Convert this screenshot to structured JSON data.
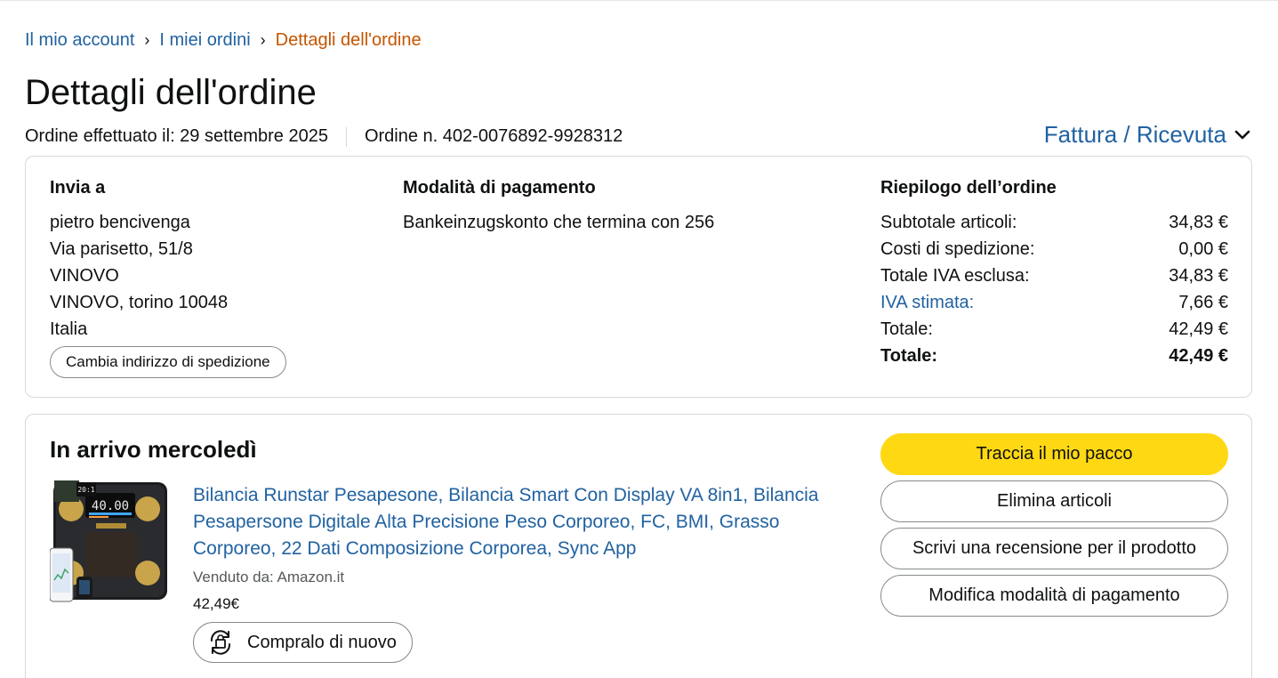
{
  "breadcrumb": {
    "items": [
      "Il mio account",
      "I miei ordini"
    ],
    "current": "Dettagli dell'ordine",
    "separator": "›"
  },
  "page_title": "Dettagli dell'ordine",
  "order_meta": {
    "placed": "Ordine effettuato il: 29 settembre 2025",
    "number": "Ordine n. 402-0076892-9928312"
  },
  "invoice": {
    "label": "Fattura / Ricevuta",
    "icon": "chevron-down-icon"
  },
  "shipping": {
    "heading": "Invia a",
    "lines": [
      "pietro bencivenga",
      "Via parisetto, 51/8",
      "VINOVO",
      "VINOVO, torino 10048",
      "Italia"
    ],
    "change_button": "Cambia indirizzo di spedizione"
  },
  "payment": {
    "heading": "Modalità di pagamento",
    "method": "Bankeinzugskonto che termina con 256"
  },
  "summary": {
    "heading": "Riepilogo dell’ordine",
    "rows": [
      {
        "k": "Subtotale articoli:",
        "v": "34,83 €"
      },
      {
        "k": "Costi di spedizione:",
        "v": "0,00 €"
      },
      {
        "k": "Totale IVA esclusa:",
        "v": "34,83 €"
      },
      {
        "k": "IVA stimata:",
        "v": "7,66 €"
      },
      {
        "k": "Totale:",
        "v": "42,49 €"
      },
      {
        "k": "Totale:",
        "v": "42,49 €"
      }
    ]
  },
  "shipment": {
    "title": "In arrivo mercoledì",
    "product": {
      "title": "Bilancia Runstar Pesapesone, Bilancia Smart Con Display VA 8in1, Bilancia Pesapersone Digitale Alta Precisione Peso Corporeo, FC, BMI, Grasso Corporeo, 22 Dati Composizione Corporea, Sync App",
      "sold_by": "Venduto da: Amazon.it",
      "price": "42,49€",
      "image_display": "40.00",
      "image_clock": "20:1",
      "buy_again": "Compralo di nuovo"
    },
    "actions": {
      "track": "Traccia il mio pacco",
      "delete": "Elimina articoli",
      "review": "Scrivi una recensione per il prodotto",
      "payment": "Modifica modalità di pagamento"
    }
  },
  "colors": {
    "link": "#2162a1",
    "breadcrumb_current": "#c45500",
    "primary_button": "#ffd814",
    "border": "#d5d9d9"
  }
}
